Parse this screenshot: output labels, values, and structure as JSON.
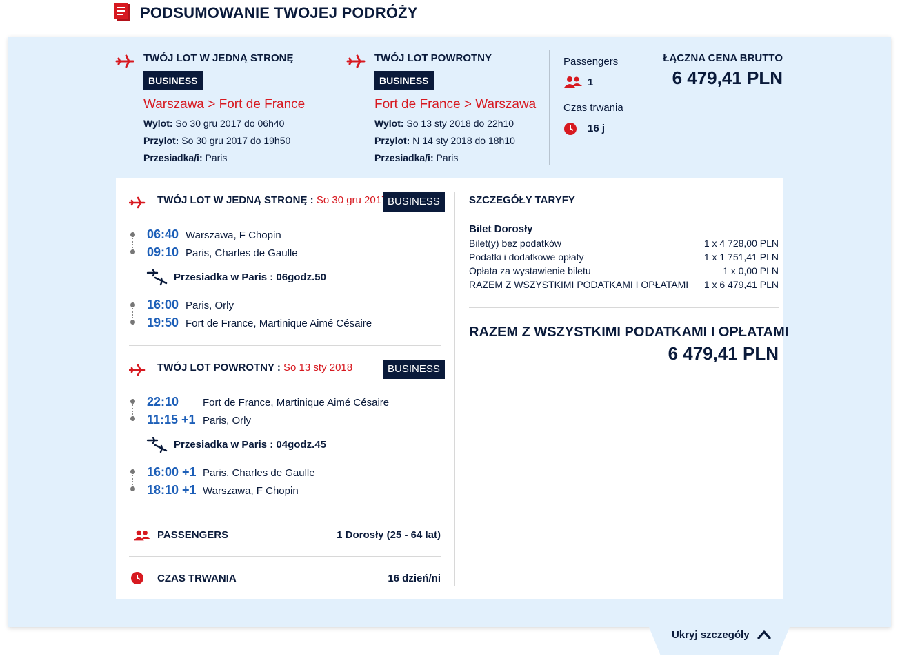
{
  "header": {
    "title": "PODSUMOWANIE TWOJEJ PODRÓŻY"
  },
  "summary": {
    "outbound": {
      "title": "TWÓJ LOT W JEDNĄ STRONĘ",
      "cabin": "BUSINESS",
      "route": "Warszawa > Fort de France",
      "departure_label": "Wylot:",
      "departure": "So 30 gru 2017 do 06h40",
      "arrival_label": "Przylot:",
      "arrival": "So 30 gru 2017 do 19h50",
      "stops_label": "Przesiadka/i:",
      "stops": "Paris"
    },
    "inbound": {
      "title": "TWÓJ LOT POWROTNY",
      "cabin": "BUSINESS",
      "route": "Fort de France > Warszawa",
      "departure_label": "Wylot:",
      "departure": "So 13 sty 2018 do 22h10",
      "arrival_label": "Przylot:",
      "arrival": "N 14 sty 2018 do 18h10",
      "stops_label": "Przesiadka/i:",
      "stops": "Paris"
    },
    "passengers_label": "Passengers",
    "passengers_count": "1",
    "duration_label": "Czas trwania",
    "duration_value": "16 j",
    "total_label": "ŁĄCZNA CENA BRUTTO",
    "total_value": "6 479,41 PLN"
  },
  "details": {
    "outbound": {
      "title": "TWÓJ LOT W JEDNĄ STRONĘ : ",
      "date": "So 30 gru 2017",
      "cabin": "BUSINESS",
      "seg1": [
        {
          "time": "06:40",
          "place": "Warszawa, F Chopin"
        },
        {
          "time": "09:10",
          "place": "Paris, Charles de Gaulle"
        }
      ],
      "transfer": "Przesiadka w Paris : 06godz.50",
      "seg2": [
        {
          "time": "16:00",
          "place": "Paris, Orly"
        },
        {
          "time": "19:50",
          "place": "Fort de France, Martinique Aimé Césaire"
        }
      ]
    },
    "inbound": {
      "title": "TWÓJ LOT POWROTNY : ",
      "date": "So 13 sty 2018",
      "cabin": "BUSINESS",
      "seg1": [
        {
          "time": "22:10",
          "place": "Fort de France, Martinique Aimé Césaire"
        },
        {
          "time": "11:15 +1",
          "place": "Paris, Orly"
        }
      ],
      "transfer": "Przesiadka w Paris : 04godz.45",
      "seg2": [
        {
          "time": "16:00 +1",
          "place": "Paris, Charles de Gaulle"
        },
        {
          "time": "18:10 +1",
          "place": "Warszawa, F Chopin"
        }
      ]
    },
    "passengers_label": "PASSENGERS",
    "passengers_value": "1 Dorosły (25 - 64 lat)",
    "duration_label": "CZAS TRWANIA",
    "duration_value": "16 dzień/ni"
  },
  "tariff": {
    "title": "SZCZEGÓŁY TARYFY",
    "subtitle": "Bilet Dorosły",
    "rows": [
      {
        "label": "Bilet(y) bez podatków",
        "value": "1 x 4 728,00 PLN"
      },
      {
        "label": "Podatki i dodatkowe opłaty",
        "value": "1 x 1 751,41 PLN"
      },
      {
        "label": "Opłata za wystawienie biletu",
        "value": "1 x 0,00 PLN"
      },
      {
        "label": "RAZEM Z WSZYSTKIMI PODATKAMI I OPŁATAMI",
        "value": "1 x 6 479,41 PLN"
      }
    ],
    "total_label": "RAZEM Z WSZYSTKIMI PODATKAMI I OPŁATAMI",
    "total_value": "6 479,41 PLN"
  },
  "footer": {
    "hide_label": "Ukryj szczegóły"
  },
  "colors": {
    "accent_red": "#d71920",
    "navy": "#0a1a3a",
    "time_blue": "#1d5fb8",
    "panel_bg": "#e2f0fc"
  }
}
